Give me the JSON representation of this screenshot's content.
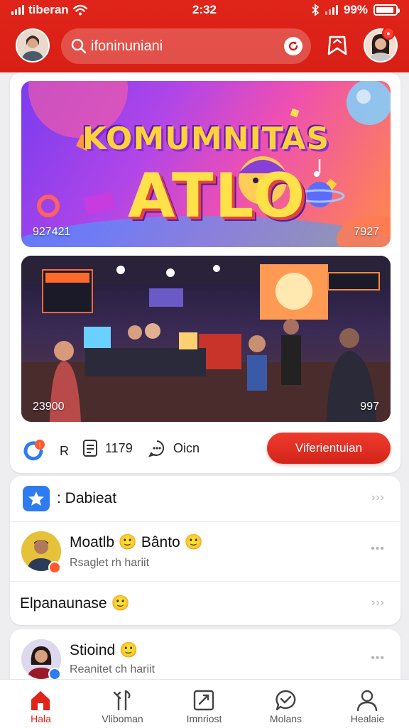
{
  "status_bar": {
    "carrier": "tiberan",
    "time": "2:32",
    "battery": "99%"
  },
  "header": {
    "search_text": "ifoninuniani",
    "icons": [
      "avatar",
      "search-icon",
      "scan-icon",
      "bookmark-icon",
      "avatar"
    ],
    "accent_color": "#e0241a"
  },
  "feature_card": {
    "banner": {
      "title": "KOMUMNITAS",
      "subtitle": "ATLO",
      "count_left": "927421",
      "count_right": "7927"
    },
    "photo": {
      "count_left": "23900",
      "count_right": "997"
    },
    "actions": {
      "members_value": "R",
      "views_value": "1179",
      "comments_value": "Oicn",
      "join_label": "Viferientuian"
    }
  },
  "list": {
    "header_item": {
      "label": ": Dabieat"
    },
    "items": [
      {
        "name": "Moatlb 🙂 Bânto 🙂",
        "subtitle": "Rsaglet rh hariit"
      },
      {
        "name": "Elpanaunase 🙂",
        "subtitle": ""
      },
      {
        "name": "Stioind 🙂",
        "subtitle": "Reanitet ch hariit"
      }
    ],
    "more_symbol": "›››"
  },
  "tabbar": {
    "items": [
      {
        "label": "Hala",
        "icon": "home-icon",
        "active": true
      },
      {
        "label": "Vliboman",
        "icon": "explore-icon",
        "active": false
      },
      {
        "label": "Imnriost",
        "icon": "create-icon",
        "active": false
      },
      {
        "label": "Molans",
        "icon": "messages-icon",
        "active": false
      },
      {
        "label": "Healaie",
        "icon": "profile-icon",
        "active": false
      }
    ]
  }
}
